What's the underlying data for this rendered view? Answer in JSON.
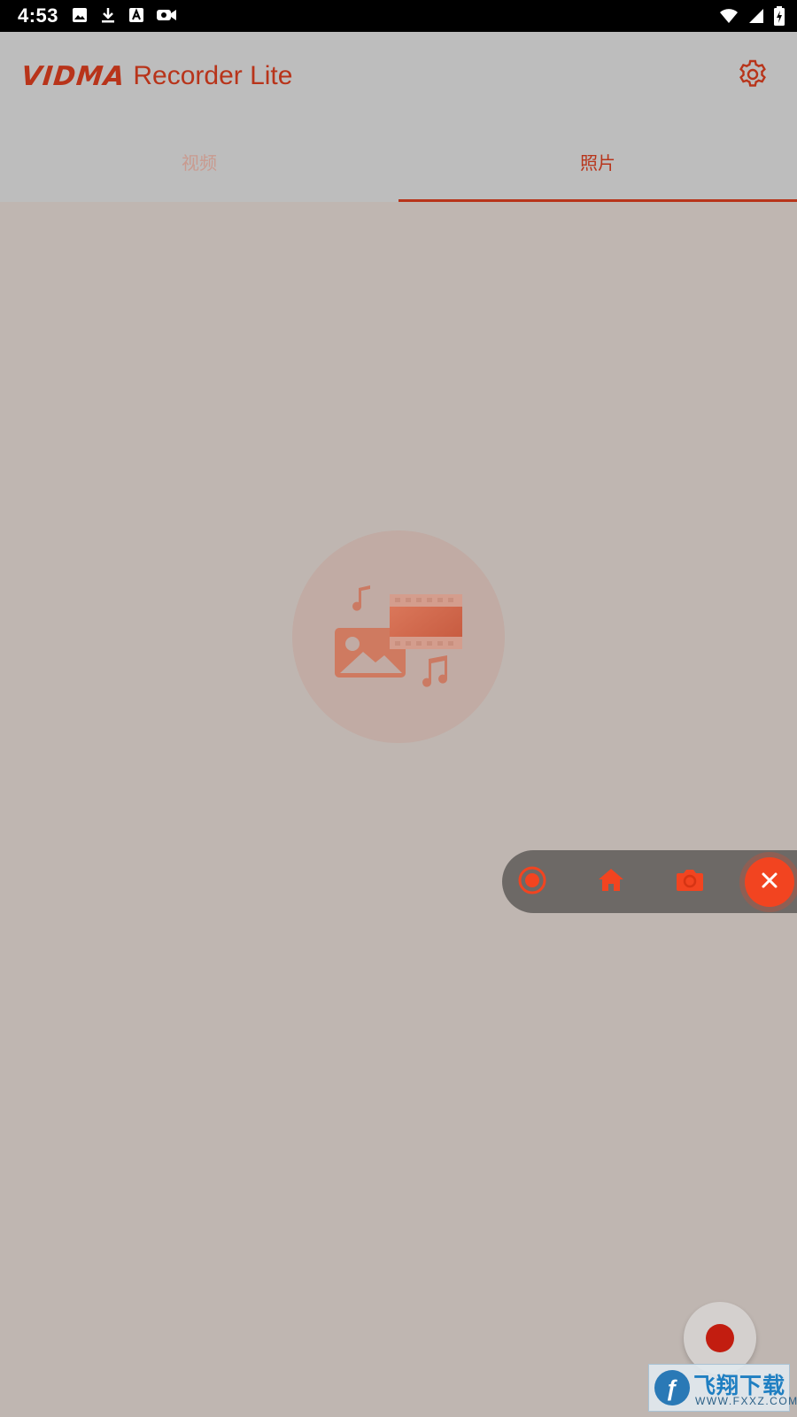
{
  "status_bar": {
    "time": "4:53",
    "left_icons": [
      "image-icon",
      "download-icon",
      "text-icon",
      "video-camera-icon"
    ],
    "right_icons": [
      "wifi-icon",
      "signal-icon",
      "battery-charging-icon"
    ]
  },
  "app_bar": {
    "brand_logo": "VIDMA",
    "brand_subtitle": "Recorder Lite",
    "settings_icon": "gear-icon"
  },
  "tabs": [
    {
      "label": "视频",
      "selected": false
    },
    {
      "label": "照片",
      "selected": true
    }
  ],
  "empty_state": {
    "icon": "media-gallery-icon"
  },
  "floating_toolbar": {
    "buttons": [
      "record-icon",
      "home-icon",
      "camera-icon",
      "close-icon"
    ]
  },
  "fab": {
    "icon": "record-dot-icon"
  },
  "watermark": {
    "title": "飞翔下载",
    "url": "WWW.FXXZ.COM"
  },
  "colors": {
    "accent": "#b8341a",
    "toolbar_red": "#f24420",
    "background": "#bfb6b1",
    "appbar": "#bdbdbd"
  }
}
